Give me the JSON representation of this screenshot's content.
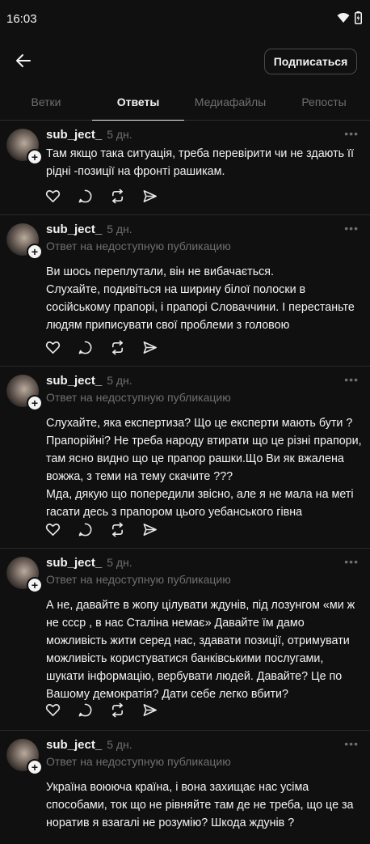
{
  "status_bar": {
    "time": "16:03"
  },
  "header": {
    "subscribe_label": "Подписаться"
  },
  "tabs": [
    {
      "label": "Ветки"
    },
    {
      "label": "Ответы"
    },
    {
      "label": "Медиафайлы"
    },
    {
      "label": "Репосты"
    }
  ],
  "posts": [
    {
      "username": "sub_ject_",
      "time": "5 дн.",
      "reply_note": "",
      "text": "Там якщо така ситуація, треба перевірити чи не здають її рідні -позиції на фронті рашикам."
    },
    {
      "username": "sub_ject_",
      "time": "5 дн.",
      "reply_note": "Ответ на недоступную публикацию",
      "text": "Ви шось переплутали, він не вибачається.\nСлухайте, подивіться на ширину білої полоски в сосійському прапорі, і прапорі Словаччини. І перестаньте людям приписувати свої проблеми з головою"
    },
    {
      "username": "sub_ject_",
      "time": "5 дн.",
      "reply_note": "Ответ на недоступную публикацию",
      "text": "Слухайте, яка експертиза? Що це експерти мають бути ? Прапорійні? Не треба народу втирати що це різні прапори, там ясно видно що це прапор рашки.Що Ви як вжалена вожжа, з теми на тему скачите ???\nМда, дякую що попередили звісно, але я не мала на меті гасати десь з прапором цього уебанського гівна"
    },
    {
      "username": "sub_ject_",
      "time": "5 дн.",
      "reply_note": "Ответ на недоступную публикацию",
      "text": "А не, давайте в жопу цілувати ждунів, під лозунгом «ми ж не ссср , в нас Сталіна немає» Давайте їм дамо можливість жити серед нас, здавати позиції, отримувати можливість користуватися банківськими послугами, шукати інформацію, вербувати людей. Давайте? Це по Вашому демократія? Дати себе легко вбити?"
    },
    {
      "username": "sub_ject_",
      "time": "5 дн.",
      "reply_note": "Ответ на недоступную публикацию",
      "text": "Україна воююча країна, і вона захищає нас усіма способами, ток що не рівняйте там де не треба, що це за норатив я взагалі не розумію? Шкода ждунів ?"
    }
  ],
  "icons": {
    "like": "heart-icon",
    "reply": "comment-icon",
    "repost": "repost-icon",
    "share": "send-icon"
  }
}
